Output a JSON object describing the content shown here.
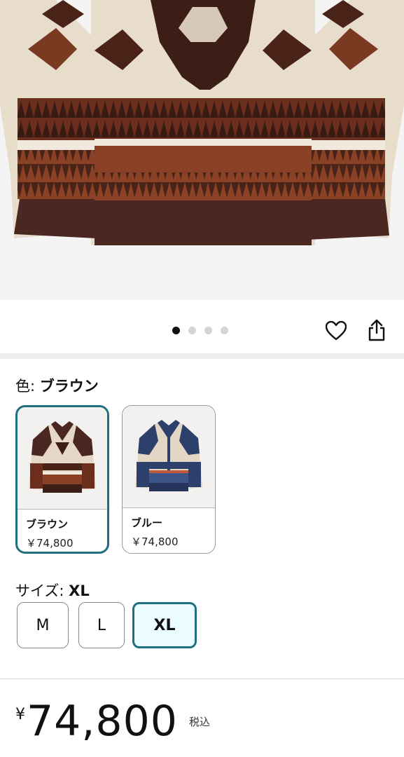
{
  "gallery": {
    "image_alt": "sweater-product-photo",
    "dot_count": 4,
    "active_dot": 1
  },
  "actions": {
    "favorite_icon": "heart-icon",
    "share_icon": "share-icon"
  },
  "color": {
    "label_prefix": "色: ",
    "selected_value": "ブラウン",
    "options": [
      {
        "name": "ブラウン",
        "price": "￥74,800",
        "selected": true
      },
      {
        "name": "ブルー",
        "price": "￥74,800",
        "selected": false
      }
    ]
  },
  "size": {
    "label_prefix": "サイズ: ",
    "selected_value": "XL",
    "options": [
      {
        "label": "M",
        "selected": false
      },
      {
        "label": "L",
        "selected": false
      },
      {
        "label": "XL",
        "selected": true
      }
    ]
  },
  "price": {
    "currency": "¥",
    "amount": "74,800",
    "tax_note": "税込"
  },
  "colors": {
    "accent": "#1f6f80",
    "selected_bg": "#eafcff"
  }
}
